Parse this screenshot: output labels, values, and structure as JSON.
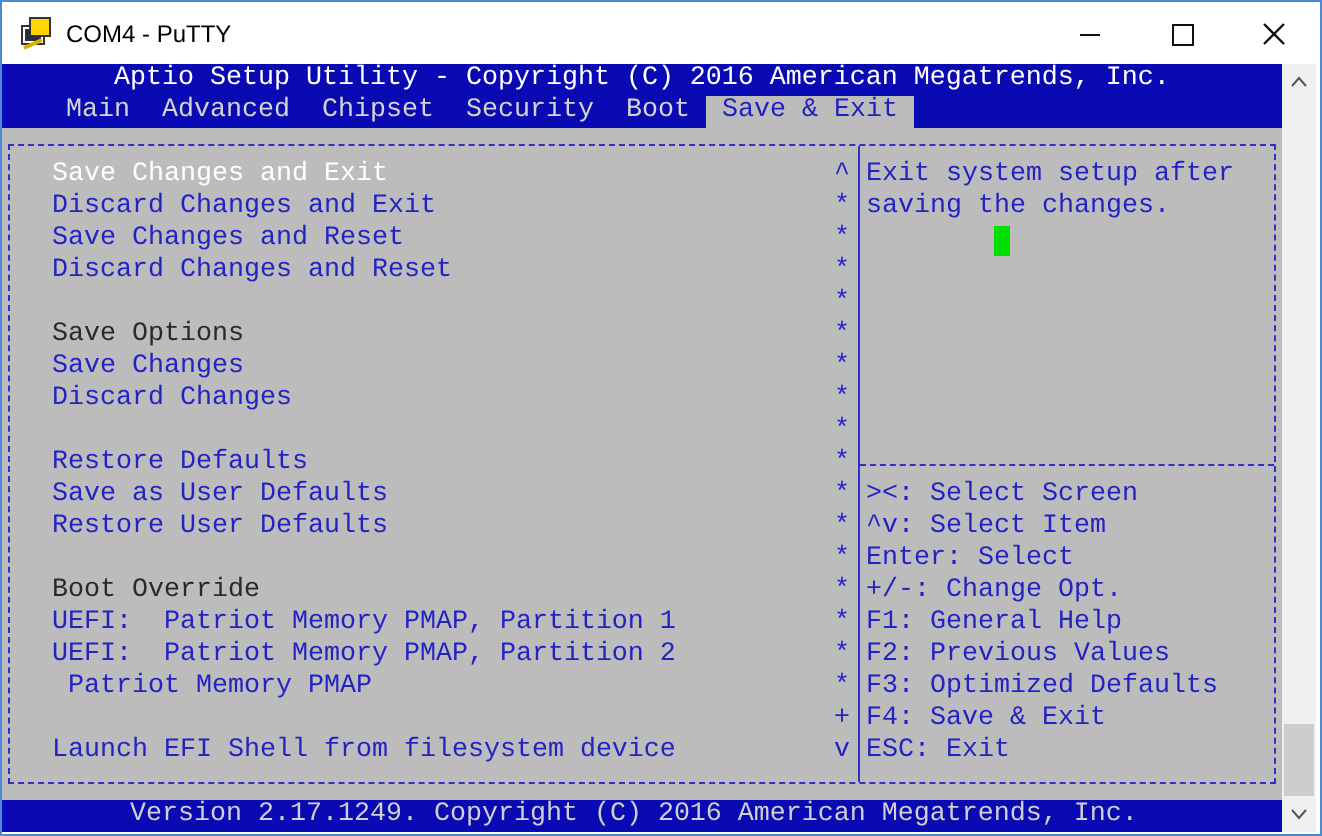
{
  "window": {
    "title": "COM4 - PuTTY"
  },
  "header": "Aptio Setup Utility - Copyright (C) 2016 American Megatrends, Inc.",
  "tabs": [
    {
      "label": "Main",
      "selected": false
    },
    {
      "label": "Advanced",
      "selected": false
    },
    {
      "label": "Chipset",
      "selected": false
    },
    {
      "label": "Security",
      "selected": false
    },
    {
      "label": "Boot",
      "selected": false
    },
    {
      "label": "Save & Exit",
      "selected": true
    }
  ],
  "menu": [
    {
      "kind": "item",
      "label": "Save Changes and Exit",
      "selected": true,
      "scroll_mark": "^"
    },
    {
      "kind": "item",
      "label": "Discard Changes and Exit",
      "selected": false,
      "scroll_mark": "*"
    },
    {
      "kind": "item",
      "label": "Save Changes and Reset",
      "selected": false,
      "scroll_mark": "*"
    },
    {
      "kind": "item",
      "label": "Discard Changes and Reset",
      "selected": false,
      "scroll_mark": "*"
    },
    {
      "kind": "blank",
      "scroll_mark": "*"
    },
    {
      "kind": "heading",
      "label": "Save Options",
      "scroll_mark": "*"
    },
    {
      "kind": "item",
      "label": "Save Changes",
      "selected": false,
      "scroll_mark": "*"
    },
    {
      "kind": "item",
      "label": "Discard Changes",
      "selected": false,
      "scroll_mark": "*"
    },
    {
      "kind": "blank",
      "scroll_mark": "*"
    },
    {
      "kind": "item",
      "label": "Restore Defaults",
      "selected": false,
      "scroll_mark": "*"
    },
    {
      "kind": "item",
      "label": "Save as User Defaults",
      "selected": false,
      "scroll_mark": "*"
    },
    {
      "kind": "item",
      "label": "Restore User Defaults",
      "selected": false,
      "scroll_mark": "*"
    },
    {
      "kind": "blank",
      "scroll_mark": "*"
    },
    {
      "kind": "heading",
      "label": "Boot Override",
      "scroll_mark": "*"
    },
    {
      "kind": "item",
      "label": "UEFI:  Patriot Memory PMAP, Partition 1",
      "selected": false,
      "scroll_mark": "*"
    },
    {
      "kind": "item",
      "label": "UEFI:  Patriot Memory PMAP, Partition 2",
      "selected": false,
      "scroll_mark": "*"
    },
    {
      "kind": "item",
      "label": " Patriot Memory PMAP",
      "selected": false,
      "scroll_mark": "*"
    },
    {
      "kind": "blank",
      "scroll_mark": "+"
    },
    {
      "kind": "item",
      "label": "Launch EFI Shell from filesystem device",
      "selected": false,
      "scroll_mark": "v"
    }
  ],
  "help": [
    "Exit system setup after",
    "saving the changes."
  ],
  "keys": [
    "><: Select Screen",
    "^v: Select Item",
    "Enter: Select",
    "+/-: Change Opt.",
    "F1: General Help",
    "F2: Previous Values",
    "F3: Optimized Defaults",
    "F4: Save & Exit",
    "ESC: Exit"
  ],
  "footer": "Version 2.17.1249. Copyright (C) 2016 American Megatrends, Inc."
}
